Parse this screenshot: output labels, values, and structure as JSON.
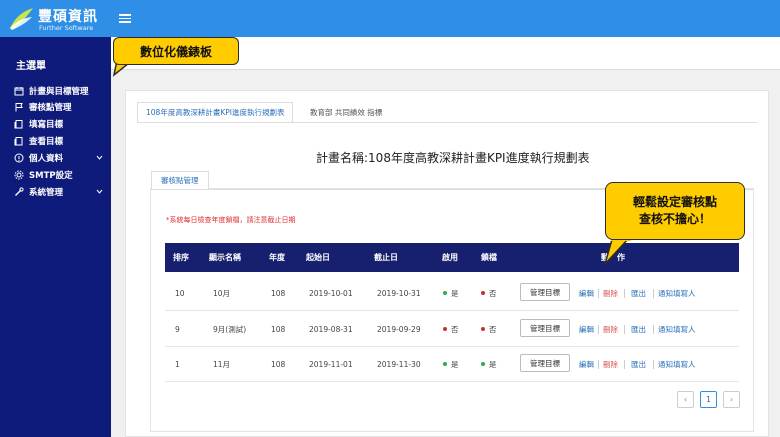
{
  "brand": {
    "title": "豐碩資訊",
    "subtitle": "Further Software"
  },
  "sidebar": {
    "heading": "主選單",
    "items": [
      {
        "label": "計畫與目標管理",
        "icon": "calendar-icon",
        "expandable": false
      },
      {
        "label": "審核點管理",
        "icon": "flag-icon",
        "expandable": false
      },
      {
        "label": "填寫目標",
        "icon": "document-icon",
        "expandable": false
      },
      {
        "label": "查看目標",
        "icon": "document-icon",
        "expandable": false
      },
      {
        "label": "個人資料",
        "icon": "user-circle-icon",
        "expandable": true
      },
      {
        "label": "SMTP設定",
        "icon": "gear-icon",
        "expandable": false
      },
      {
        "label": "系統管理",
        "icon": "wrench-icon",
        "expandable": true
      }
    ]
  },
  "callouts": {
    "dashboard": "數位化儀錶板",
    "audit_line1": "輕鬆設定審核點",
    "audit_line2": "查核不擔心！"
  },
  "tabs": [
    {
      "label": "108年度高教深耕計畫KPI進度執行規劃表",
      "active": true
    },
    {
      "label": "教育部 共同績效 指標",
      "active": false
    }
  ],
  "plan": {
    "label": "計畫名稱:108年度高教深耕計畫KPI進度執行規劃表"
  },
  "subtab": {
    "label": "審核點管理"
  },
  "note": "*系統每日檢查年度鎖檔，請注意截止日期",
  "table": {
    "headers": {
      "order": "排序",
      "name": "顯示名稱",
      "year": "年度",
      "start": "起始日",
      "end": "截止日",
      "enabled": "啟用",
      "locked": "鎖檔",
      "actions": "動　作"
    },
    "rows": [
      {
        "order": "10",
        "name": "10月",
        "year": "108",
        "start": "2019-10-01",
        "end": "2019-10-31",
        "enabled": "是",
        "locked": "否"
      },
      {
        "order": "9",
        "name": "9月(測試)",
        "year": "108",
        "start": "2019-08-31",
        "end": "2019-09-29",
        "enabled": "否",
        "locked": "否"
      },
      {
        "order": "1",
        "name": "11月",
        "year": "108",
        "start": "2019-11-01",
        "end": "2019-11-30",
        "enabled": "是",
        "locked": "是"
      }
    ],
    "row_actions": {
      "manage": "管理目標",
      "edit": "編輯",
      "delete": "刪除",
      "export": "匯出",
      "notify": "通知填寫人"
    }
  },
  "pagination": {
    "prev": "‹",
    "current": "1",
    "next": "›"
  },
  "colors": {
    "topbar": "#2f8fe6",
    "sidebar": "#0f1b7a",
    "table_header": "#16206e",
    "callout": "#ffcc00",
    "yes_dot": "#3aa84a",
    "no_dot": "#c9302c",
    "link_blue": "#2a6fb8",
    "delete_red": "#d9534f"
  }
}
